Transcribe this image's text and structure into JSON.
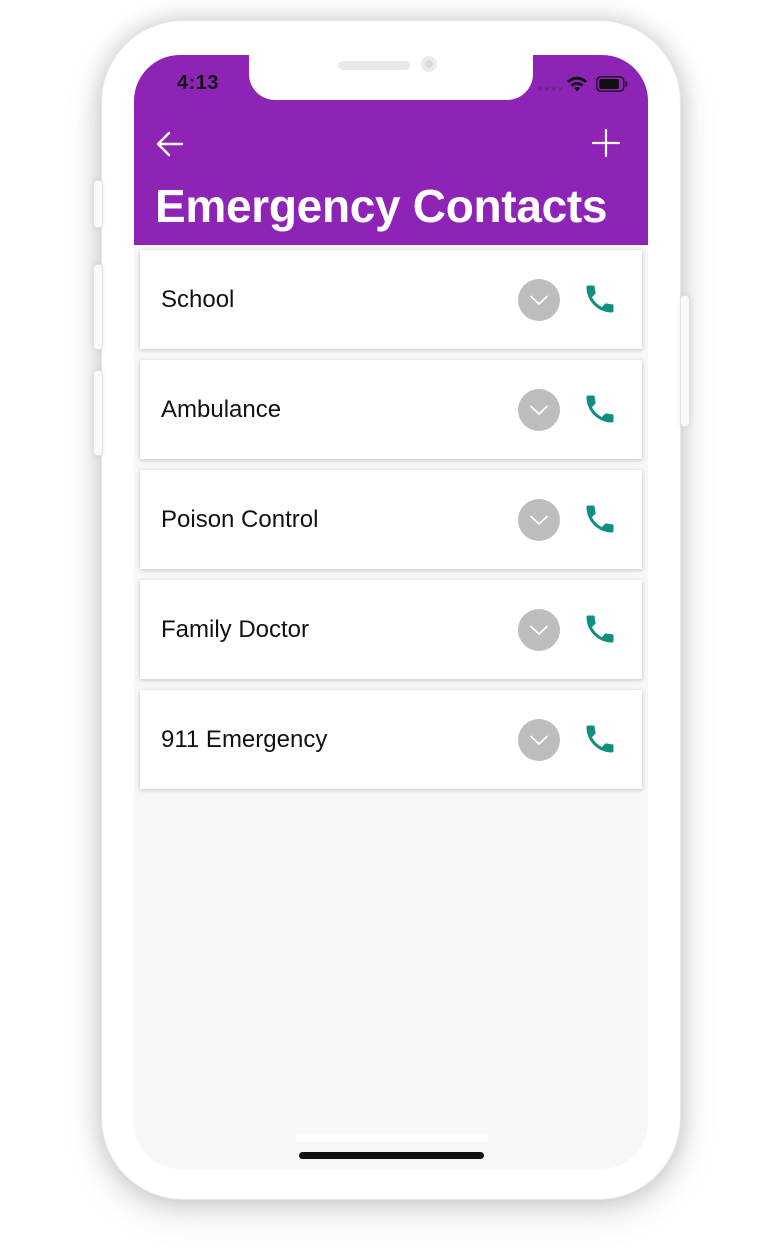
{
  "status_bar": {
    "time": "4:13"
  },
  "header": {
    "title": "Emergency Contacts",
    "back_icon": "arrow-left-icon",
    "add_icon": "plus-icon",
    "background_color": "#8e24b5"
  },
  "contacts": [
    {
      "label": "School"
    },
    {
      "label": "Ambulance"
    },
    {
      "label": "Poison Control"
    },
    {
      "label": "Family Doctor"
    },
    {
      "label": "911 Emergency"
    }
  ],
  "icons": {
    "expand": "chevron-down-icon",
    "call": "phone-icon"
  },
  "colors": {
    "accent": "#8e24b5",
    "call_icon": "#0e8f80",
    "expand_button": "#bdbdbd",
    "list_background": "#f7f7f7"
  }
}
